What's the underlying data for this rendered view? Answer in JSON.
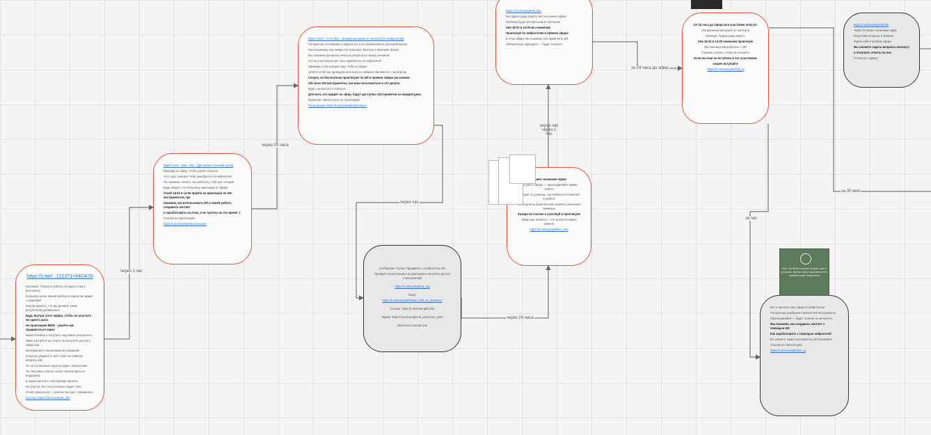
{
  "edge_labels": [
    "через 1 час",
    "через 24 часа",
    "через час",
    "через 24 часа",
    "через час\nчерез 1 час",
    "за 24 часа до эфир",
    "за час",
    "за 30 мин"
  ],
  "cards": {
    "c1": {
      "title": "https://t.me/...1213?1=84DA76",
      "lines": [
        "Напомню: Только в субботу 18 марта я могу рассказать",
        "большую кухню нашей работы в закрытом эфире с заданием",
        "внутри проекта, что мы делаем, каких результатов добиваемся",
        "Будь внутри этого эфира, чтобы не упустить ни одного шага",
        "На практикуме ВБ/И - узнаете как продвигаться через",
        "маркетплейсы и получать ощутимые результаты",
        "Имея 140 000 ₽ на старте вы получите доступ к закрытым",
        "материалам и пошаговым инструкциям",
        "Когда вы увидите в чате ответ на главные вопросы ИИ",
        "Ты не останешься один на один с вопросами",
        "Ты получишь ответы на все свои вопросы и поддержку",
        "в закрытом чате с экспертами проекта",
        "Не упусти! Это точно полезно будет тебе",
        "Успей записаться — количество мест ограничено",
        "Ссылка: https://t.me/example_link"
      ]
    },
    "c2": {
      "lines": [
        "https://t.me/...Mad...40v... (доступна в течение суток)",
        "Приходи на эфир, чтобы узнать больше",
        "Этот курс поможет тебе разобраться в нейросетях",
        "Ты сможешь понять, как работать с ИИ уже сегодня",
        "Будь уверен, что получишь максимум от эфира",
        "Успей 18.03 в 14:00 прийти на практикум по ИИ-инструментам, где",
        "покажем, как использовать ИИ в своей работе, создавать контент",
        "и зарабатывать на этом, и не тратить на это время :)",
        "Ссылка на трансляцию",
        "https://t.me/example/ai-practicum"
      ]
    },
    "c3": {
      "lines": [
        "https://t.me/...?v=ProDe... (новый материал от эксперта по нейросетям)",
        "Сегодня мы поговорим о нейросетях и ее применении в реальной жизни",
        "Рассказываем, как нейросети помогают бизнесу и экономят время",
        "Мы покажем реальные кейсы и результаты наших учеников",
        "Кто из участников уже смог заработать на нейросетях",
        "Примеры и инструкции ждут тебя на эфире",
        "18.03 в 14:00 мы проведем интенсив по нейросетям вместе с экспертом",
        "Скорее, на бесплатном практикуме по ИИ в прямом эфире расскажем",
        "обо всех ИИ-инструментах, как ими пользоваться и что делать",
        "Будет интересно и полезно!",
        "Для всех, кто придет на эфир, будут доступны 140 промптов на каждый день",
        "Ждём вас обязательно на практикуме",
        "Регистрация: https://t.me/example/practicum"
      ]
    },
    "c4": {
      "lines": [
        "Сообщение: Лучше Продавать с Нейросетью ИИ",
        "Пройдите регистрацию на практикум и получите доступ к материалам",
        "https://t.me/example/ai_reg",
        "Вход:",
        "https://t.me/example/stream_link_ai_practicum",
        "Ссылка: https://t.me/example/chat",
        "Ждём: https://t.me/example/ai_practicum_start",
        "Приятного просмотра!"
      ]
    },
    "c5": {
      "lines": [
        "https://t.me/example/ai_live",
        "Мы будем рады видеть вас на нашем эфире",
        "Вебинар будет интересным и полезным",
        "Уже 18.03 в 14:00 мы начинаем",
        "Практикум по нейросетям в прямом эфире",
        "В этом эфире мы покажем, как применять ИИ",
        "Обязательно приходите — будет полезно"
      ]
    },
    "c6": {
      "lines": [
        "Привет, начинаем эфир!",
        "Мы уже в эфире — присоединяйся прямо сейчас",
        "Сегодня ты узнаешь, как нейросети помогают в работе",
        "Ты получишь практические знания и реальные примеры",
        "Заходи по ссылке и участвуй в практикуме",
        "Эфир уже начался — не пропусти самое важное",
        "https://t.me/example/live_now"
      ]
    },
    "c7": {
      "lines": [
        "ЗА 24 часа до эфира все участники получат",
        "специальный материал от эксперта",
        "Приходи, будем рады видеть",
        "Уже 18.03 в 14:00 начинаем практикум",
        "Мы покажем как работать с ИИ",
        "Сохрани ссылку, чтобы не потерять",
        "Если вы еще не вступили в чат участников",
        "скорее вступайте",
        "https://t.me/example/chat_ai"
      ]
    },
    "c8": {
      "lines": [
        "https://t.me/example/30min",
        "Через 30 минут начинаем эфир",
        "Подготовь вопросы и блокнот",
        "Ждём тебя в прямом эфире",
        "Вы сможете задать вопросы эксперту",
        "и получить ответы на них",
        "Готовься к эфиру!"
      ]
    },
    "c9": {
      "lines": [
        "Вот и начался наш эфир по нейросетям",
        "Сегодня мы разберем главные ИИ-инструменты",
        "Присоединяйся — будет полезно и интересно",
        "Мы покажем, как создавать контент с помощью ИИ",
        "Как зарабатывать с помощью нейросетей",
        "Вы узнаете, какие инструменты использовать",
        "Ссылка на трансляцию:",
        "https://t.me/example/live_ai"
      ]
    }
  },
  "green_image_text": "Все, что было в вашем отпуске, уже в прошлом. Время новых возможностей и знаний в мире нейросетей"
}
